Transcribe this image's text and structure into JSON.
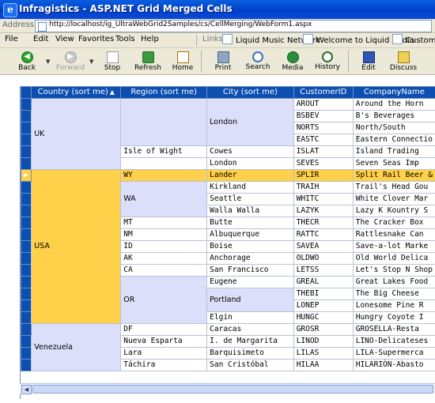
{
  "window": {
    "title": "Infragistics - ASP.NET Grid Merged Cells",
    "icon": "ie-logo-icon"
  },
  "address": {
    "label": "Address",
    "url": "http://localhost/ig_UltraWebGrid2Samples/cs/CellMerging/WebForm1.aspx"
  },
  "menu": [
    "File",
    "Edit",
    "View",
    "Favorites",
    "Tools",
    "Help"
  ],
  "links": {
    "label": "Links",
    "items": [
      "Liquid Music Network",
      "Welcome to Liquid Audio",
      "Customize"
    ]
  },
  "toolbar": [
    {
      "label": "Back",
      "icon": "back-icon"
    },
    {
      "label": "Forward",
      "icon": "forward-icon"
    },
    {
      "label": "Stop",
      "icon": "stop-icon"
    },
    {
      "label": "Refresh",
      "icon": "refresh-icon"
    },
    {
      "label": "Home",
      "icon": "home-icon"
    },
    {
      "label": "Print",
      "icon": "print-icon"
    },
    {
      "label": "Search",
      "icon": "search-icon"
    },
    {
      "label": "Media",
      "icon": "media-icon"
    },
    {
      "label": "History",
      "icon": "history-icon"
    },
    {
      "label": "Edit",
      "icon": "edit-icon"
    },
    {
      "label": "Discuss",
      "icon": "discuss-icon"
    }
  ],
  "grid": {
    "columns": [
      "Country (sort me)",
      "Region (sort me)",
      "City (sort me)",
      "CustomerID",
      "CompanyName"
    ],
    "sorted_column": "Country (sort me)",
    "sort_direction": "ascending",
    "selected_row_customer": "SPLIR",
    "rows": [
      {
        "country": "UK",
        "region": "",
        "city": "London",
        "id": "AROUT",
        "company": "Around the Horn"
      },
      {
        "country": "UK",
        "region": "",
        "city": "London",
        "id": "BSBEV",
        "company": "B's Beverages"
      },
      {
        "country": "UK",
        "region": "",
        "city": "London",
        "id": "NORTS",
        "company": "North/South"
      },
      {
        "country": "UK",
        "region": "",
        "city": "London",
        "id": "EASTC",
        "company": "Eastern Connectio"
      },
      {
        "country": "UK",
        "region": "Isle of Wight",
        "city": "Cowes",
        "id": "ISLAT",
        "company": "Island Trading"
      },
      {
        "country": "UK",
        "region": "",
        "city": "London",
        "id": "SEVES",
        "company": "Seven Seas Imp"
      },
      {
        "country": "USA",
        "region": "WY",
        "city": "Lander",
        "id": "SPLIR",
        "company": "Split Rail Beer &"
      },
      {
        "country": "USA",
        "region": "WA",
        "city": "Kirkland",
        "id": "TRAIH",
        "company": "Trail's Head Gou"
      },
      {
        "country": "USA",
        "region": "WA",
        "city": "Seattle",
        "id": "WHITC",
        "company": "White Clover Mar"
      },
      {
        "country": "USA",
        "region": "WA",
        "city": "Walla Walla",
        "id": "LAZYK",
        "company": "Lazy K Kountry S"
      },
      {
        "country": "USA",
        "region": "MT",
        "city": "Butte",
        "id": "THECR",
        "company": "The Cracker Box"
      },
      {
        "country": "USA",
        "region": "NM",
        "city": "Albuquerque",
        "id": "RATTC",
        "company": "Rattlesnake Can"
      },
      {
        "country": "USA",
        "region": "ID",
        "city": "Boise",
        "id": "SAVEA",
        "company": "Save-a-lot Marke"
      },
      {
        "country": "USA",
        "region": "AK",
        "city": "Anchorage",
        "id": "OLDWO",
        "company": "Old World Delica"
      },
      {
        "country": "USA",
        "region": "CA",
        "city": "San Francisco",
        "id": "LETSS",
        "company": "Let's Stop N Shop"
      },
      {
        "country": "USA",
        "region": "OR",
        "city": "Eugene",
        "id": "GREAL",
        "company": "Great Lakes Food"
      },
      {
        "country": "USA",
        "region": "OR",
        "city": "Portland",
        "id": "THEBI",
        "company": "The Big Cheese"
      },
      {
        "country": "USA",
        "region": "OR",
        "city": "Portland",
        "id": "LONEP",
        "company": "Lonesome Pine R"
      },
      {
        "country": "USA",
        "region": "OR",
        "city": "Elgin",
        "id": "HUNGC",
        "company": "Hungry Coyote I"
      },
      {
        "country": "Venezuela",
        "region": "DF",
        "city": "Caracas",
        "id": "GROSR",
        "company": "GROSELLA-Resta"
      },
      {
        "country": "Venezuela",
        "region": "Nueva Esparta",
        "city": "I. de Margarita",
        "id": "LINOD",
        "company": "LINO-Delicateses"
      },
      {
        "country": "Venezuela",
        "region": "Lara",
        "city": "Barquisimeto",
        "id": "LILAS",
        "company": "LILA-Supermerca"
      },
      {
        "country": "Venezuela",
        "region": "Táchira",
        "city": "San Cristóbal",
        "id": "HILAA",
        "company": "HILARIÓN-Abasto"
      }
    ]
  }
}
